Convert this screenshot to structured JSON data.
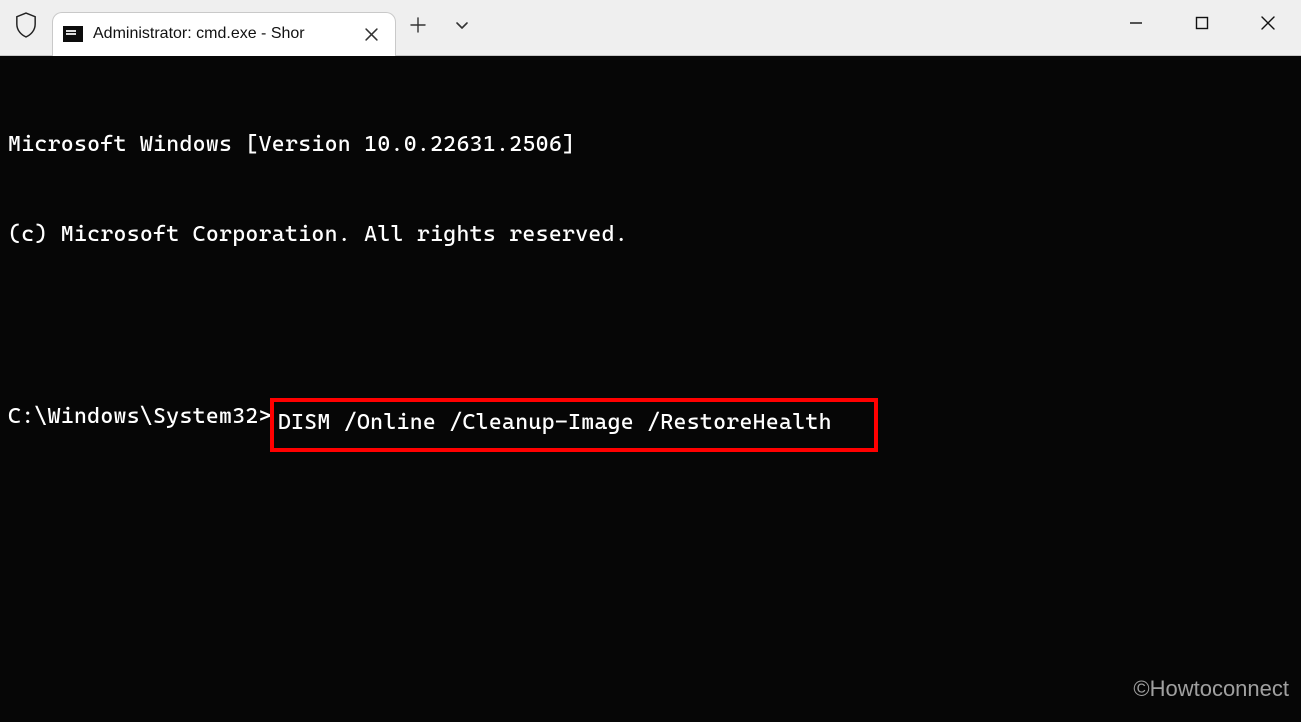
{
  "titlebar": {
    "tab_label": "Administrator: cmd.exe - Shor"
  },
  "terminal": {
    "version_line": "Microsoft Windows [Version 10.0.22631.2506]",
    "copyright_line": "(c) Microsoft Corporation. All rights reserved.",
    "prompt": "C:\\Windows\\System32>",
    "command": "DISM /Online /Cleanup-Image /RestoreHealth"
  },
  "watermark": "©Howtoconnect"
}
